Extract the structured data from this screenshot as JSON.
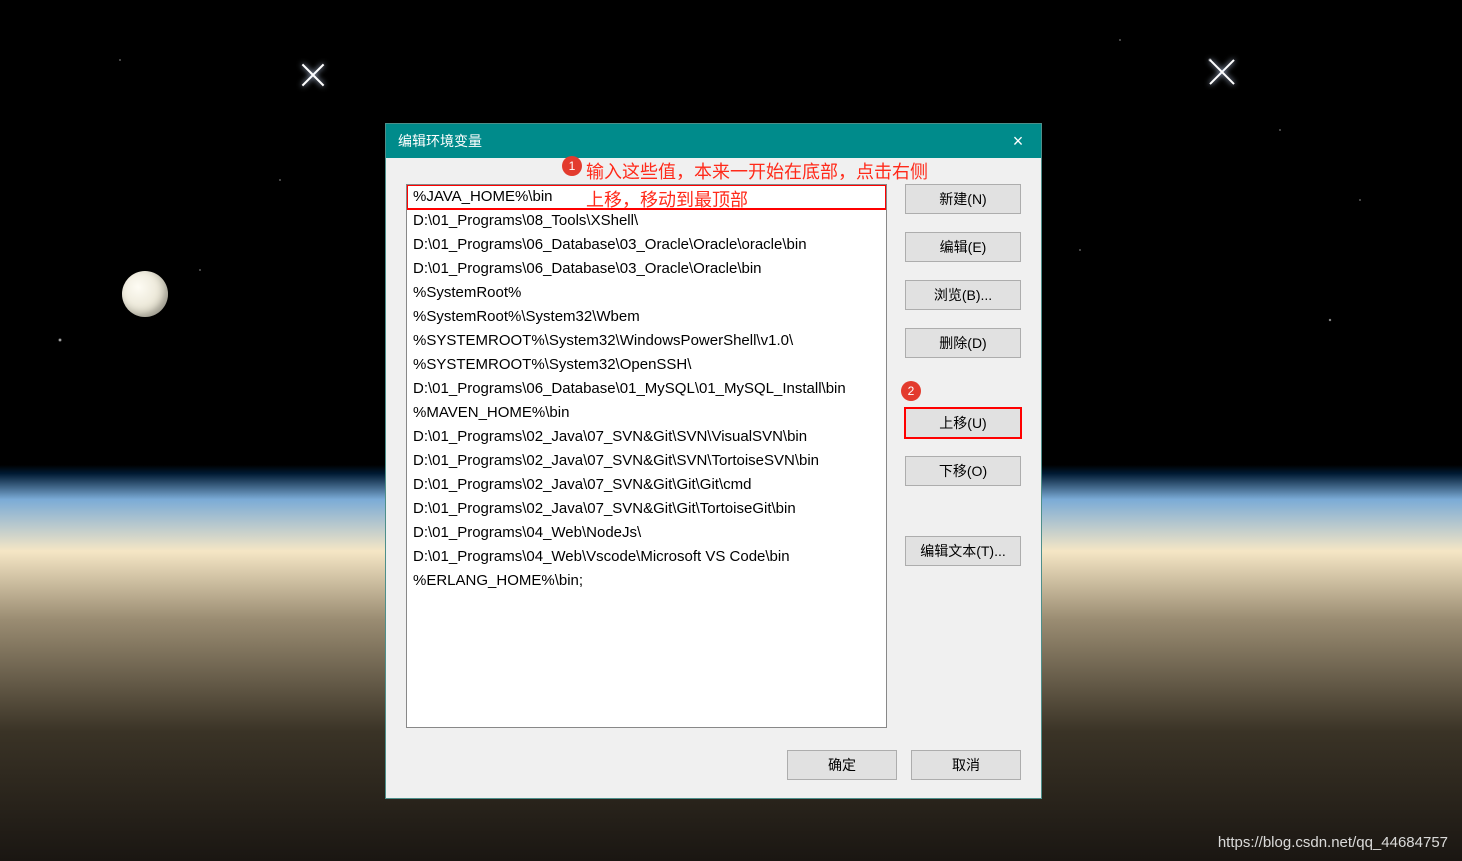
{
  "dialog": {
    "title": "编辑环境变量",
    "close": "×",
    "list": [
      "%JAVA_HOME%\\bin",
      "D:\\01_Programs\\08_Tools\\XShell\\",
      "D:\\01_Programs\\06_Database\\03_Oracle\\Oracle\\oracle\\bin",
      "D:\\01_Programs\\06_Database\\03_Oracle\\Oracle\\bin",
      "%SystemRoot%",
      "%SystemRoot%\\System32\\Wbem",
      "%SYSTEMROOT%\\System32\\WindowsPowerShell\\v1.0\\",
      "%SYSTEMROOT%\\System32\\OpenSSH\\",
      "D:\\01_Programs\\06_Database\\01_MySQL\\01_MySQL_Install\\bin",
      "%MAVEN_HOME%\\bin",
      "D:\\01_Programs\\02_Java\\07_SVN&Git\\SVN\\VisualSVN\\bin",
      "D:\\01_Programs\\02_Java\\07_SVN&Git\\SVN\\TortoiseSVN\\bin",
      "D:\\01_Programs\\02_Java\\07_SVN&Git\\Git\\Git\\cmd",
      "D:\\01_Programs\\02_Java\\07_SVN&Git\\Git\\TortoiseGit\\bin",
      "D:\\01_Programs\\04_Web\\NodeJs\\",
      "D:\\01_Programs\\04_Web\\Vscode\\Microsoft VS Code\\bin",
      "%ERLANG_HOME%\\bin;"
    ],
    "selected_index": 0,
    "buttons": {
      "new": "新建(N)",
      "edit": "编辑(E)",
      "browse": "浏览(B)...",
      "delete": "删除(D)",
      "up": "上移(U)",
      "down": "下移(O)",
      "edit_text": "编辑文本(T)..."
    },
    "footer": {
      "ok": "确定",
      "cancel": "取消"
    }
  },
  "annotations": {
    "badge1": "1",
    "badge2": "2",
    "line1": "输入这些值，本来一开始在底部，点击右侧",
    "line2": "上移，移动到最顶部"
  },
  "watermark": "https://blog.csdn.net/qq_44684757"
}
